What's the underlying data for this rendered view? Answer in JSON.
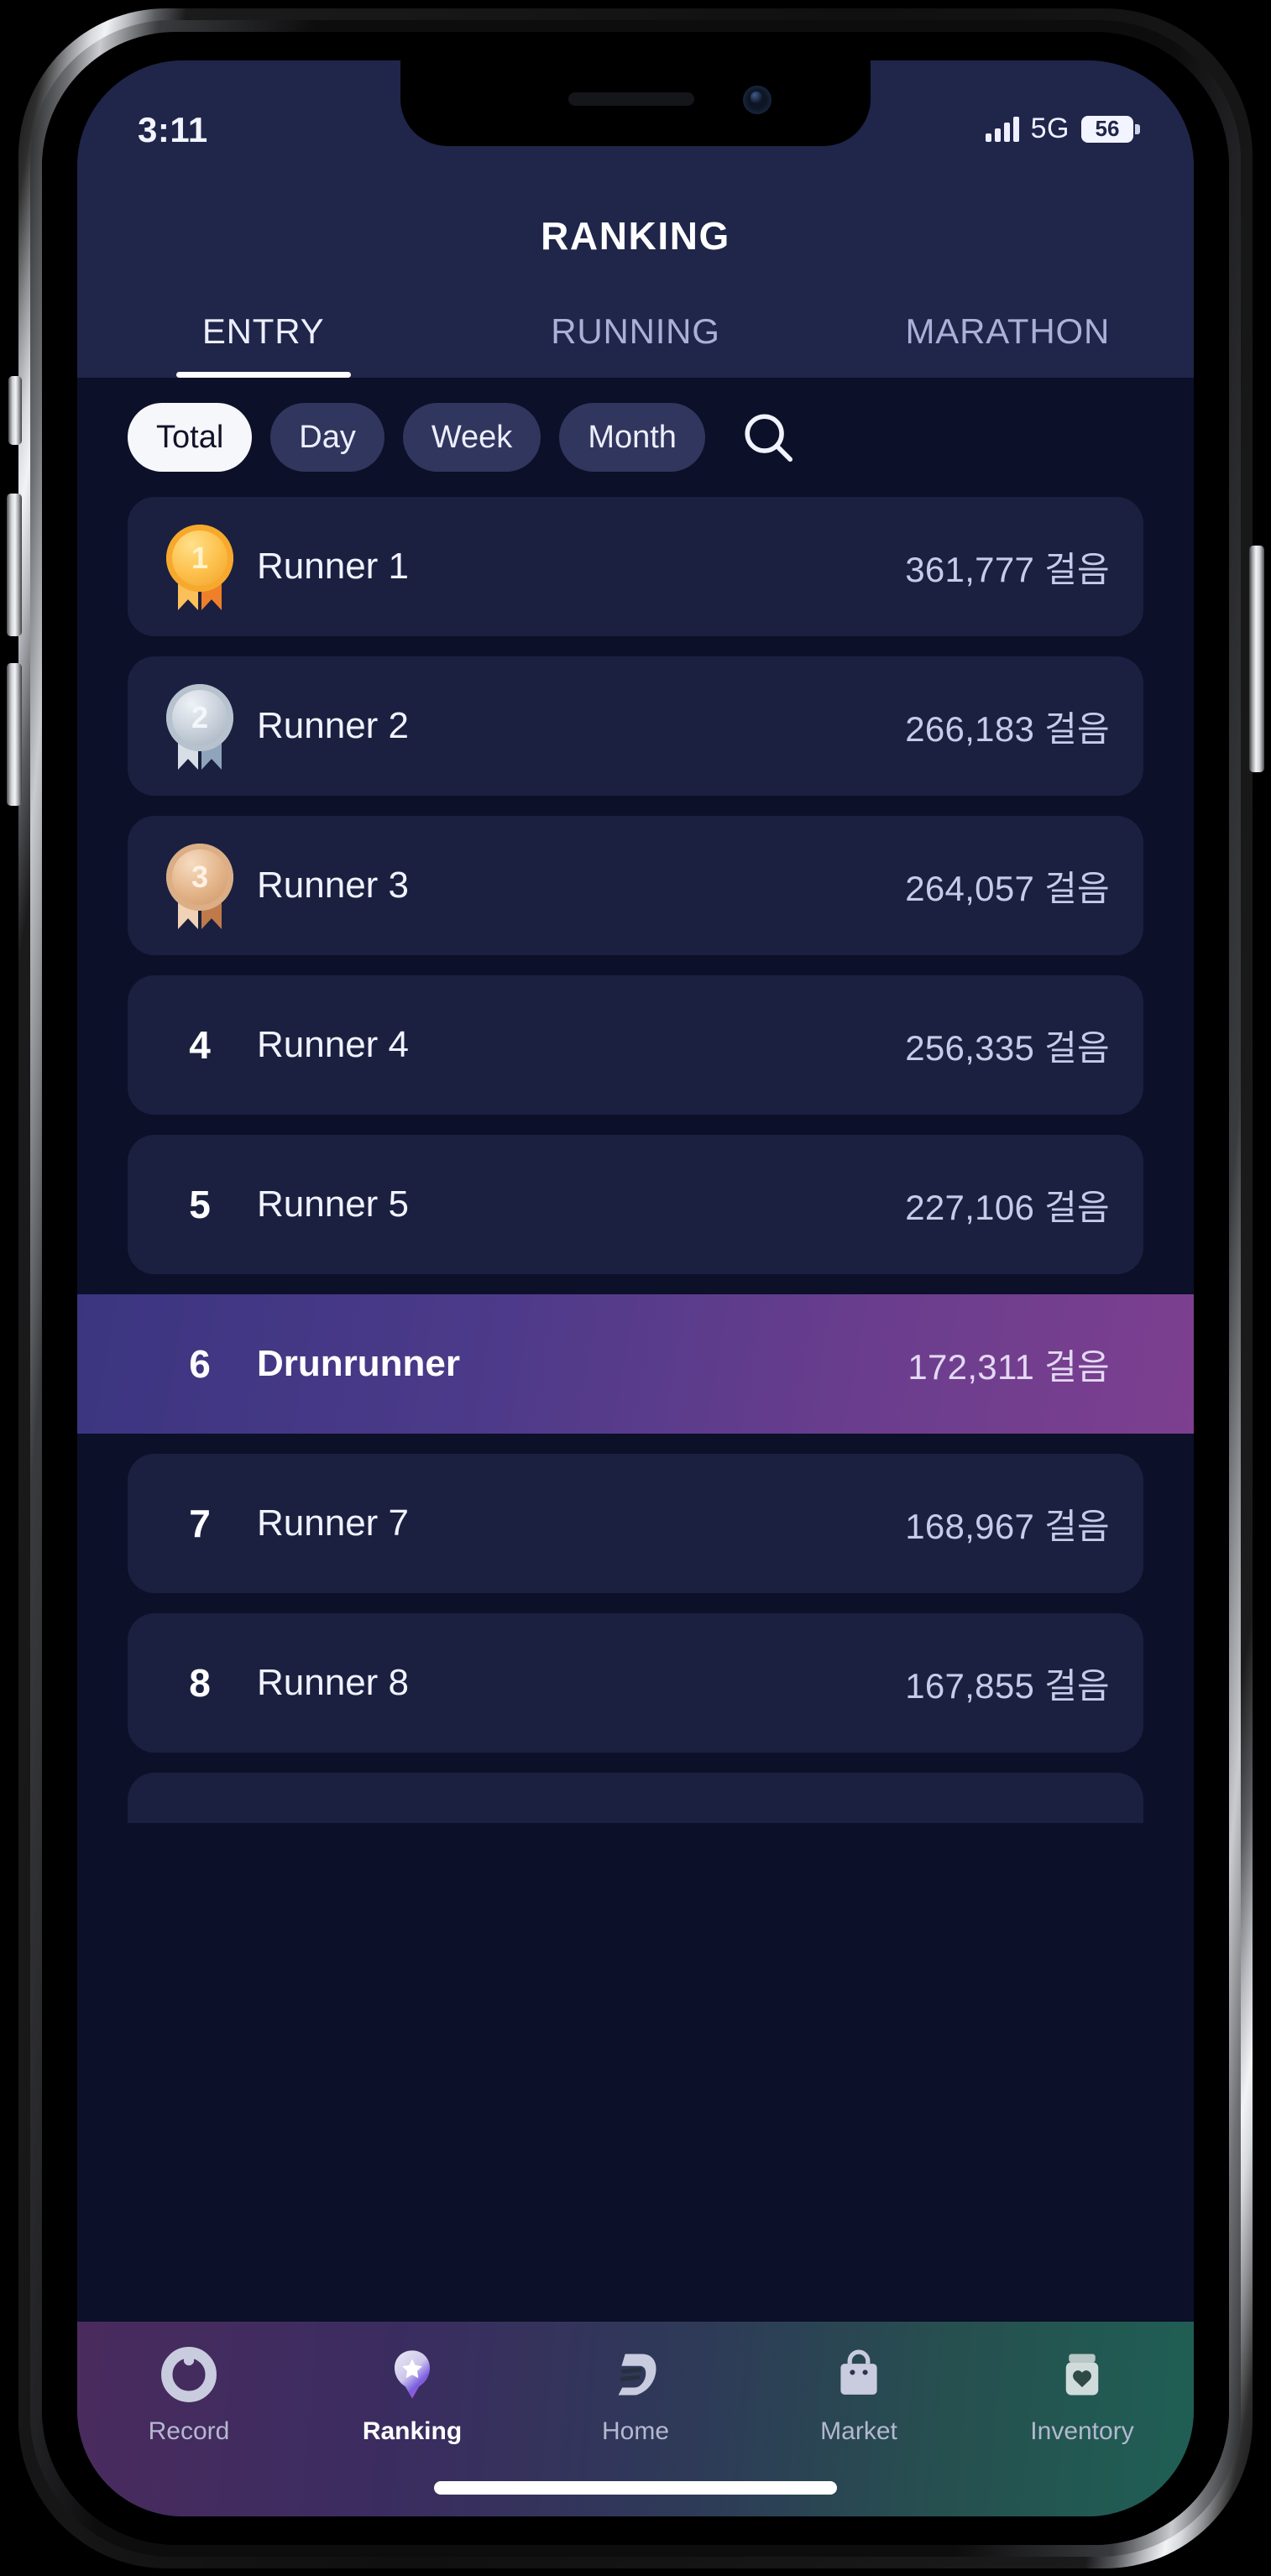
{
  "status_bar": {
    "time": "3:11",
    "network": "5G",
    "battery": "56",
    "signal_icon": "cellular-bars-icon",
    "battery_icon": "battery-icon"
  },
  "header": {
    "title": "RANKING"
  },
  "tabs": [
    {
      "label": "ENTRY",
      "active": true
    },
    {
      "label": "RUNNING",
      "active": false
    },
    {
      "label": "MARATHON",
      "active": false
    }
  ],
  "filters": {
    "chips": [
      {
        "label": "Total",
        "active": true
      },
      {
        "label": "Day",
        "active": false
      },
      {
        "label": "Week",
        "active": false
      },
      {
        "label": "Month",
        "active": false
      }
    ],
    "search_icon": "search-icon"
  },
  "ranking": {
    "unit": "걸음",
    "rows": [
      {
        "rank": "1",
        "medal": "gold",
        "name": "Runner 1",
        "steps": "361,777 걸음",
        "highlighted": false
      },
      {
        "rank": "2",
        "medal": "silver",
        "name": "Runner 2",
        "steps": "266,183 걸음",
        "highlighted": false
      },
      {
        "rank": "3",
        "medal": "bronze",
        "name": "Runner 3",
        "steps": "264,057 걸음",
        "highlighted": false
      },
      {
        "rank": "4",
        "medal": "",
        "name": "Runner 4",
        "steps": "256,335 걸음",
        "highlighted": false
      },
      {
        "rank": "5",
        "medal": "",
        "name": "Runner 5",
        "steps": "227,106 걸음",
        "highlighted": false
      },
      {
        "rank": "6",
        "medal": "",
        "name": "Drunrunner",
        "steps": "172,311 걸음",
        "highlighted": true
      },
      {
        "rank": "7",
        "medal": "",
        "name": "Runner 7",
        "steps": "168,967 걸음",
        "highlighted": false
      },
      {
        "rank": "8",
        "medal": "",
        "name": "Runner 8",
        "steps": "167,855 걸음",
        "highlighted": false
      }
    ]
  },
  "bottom_nav": [
    {
      "label": "Record",
      "icon": "record-ring-icon",
      "active": false
    },
    {
      "label": "Ranking",
      "icon": "badge-star-icon",
      "active": true
    },
    {
      "label": "Home",
      "icon": "d-logo-icon",
      "active": false
    },
    {
      "label": "Market",
      "icon": "shopping-bag-icon",
      "active": false
    },
    {
      "label": "Inventory",
      "icon": "jar-heart-icon",
      "active": false
    }
  ],
  "colors": {
    "screen_bg": "#0c1028",
    "header_bg": "#20254a",
    "row_bg": "#1b2040",
    "highlight_start": "#3b3580",
    "highlight_end": "#7d3f8f",
    "accent_white": "#ffffff"
  }
}
